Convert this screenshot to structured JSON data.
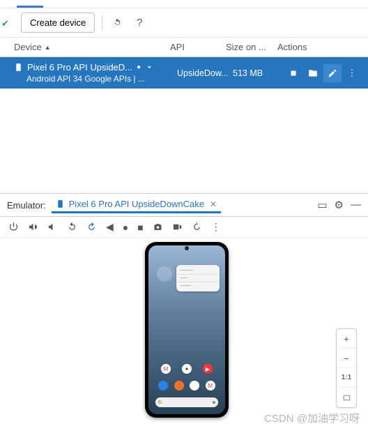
{
  "toolbar": {
    "create_label": "Create device"
  },
  "columns": {
    "device": "Device",
    "api": "API",
    "size": "Size on ...",
    "actions": "Actions"
  },
  "row": {
    "name": "Pixel 6 Pro API UpsideD...",
    "sub": "Android API 34 Google APIs | ...",
    "api": "UpsideDow...",
    "size": "513 MB"
  },
  "emulator": {
    "label": "Emulator:",
    "tab": "Pixel 6 Pro API UpsideDownCake"
  },
  "zoom": {
    "ratio": "1:1"
  },
  "watermark": "CSDN @加油学习呀"
}
